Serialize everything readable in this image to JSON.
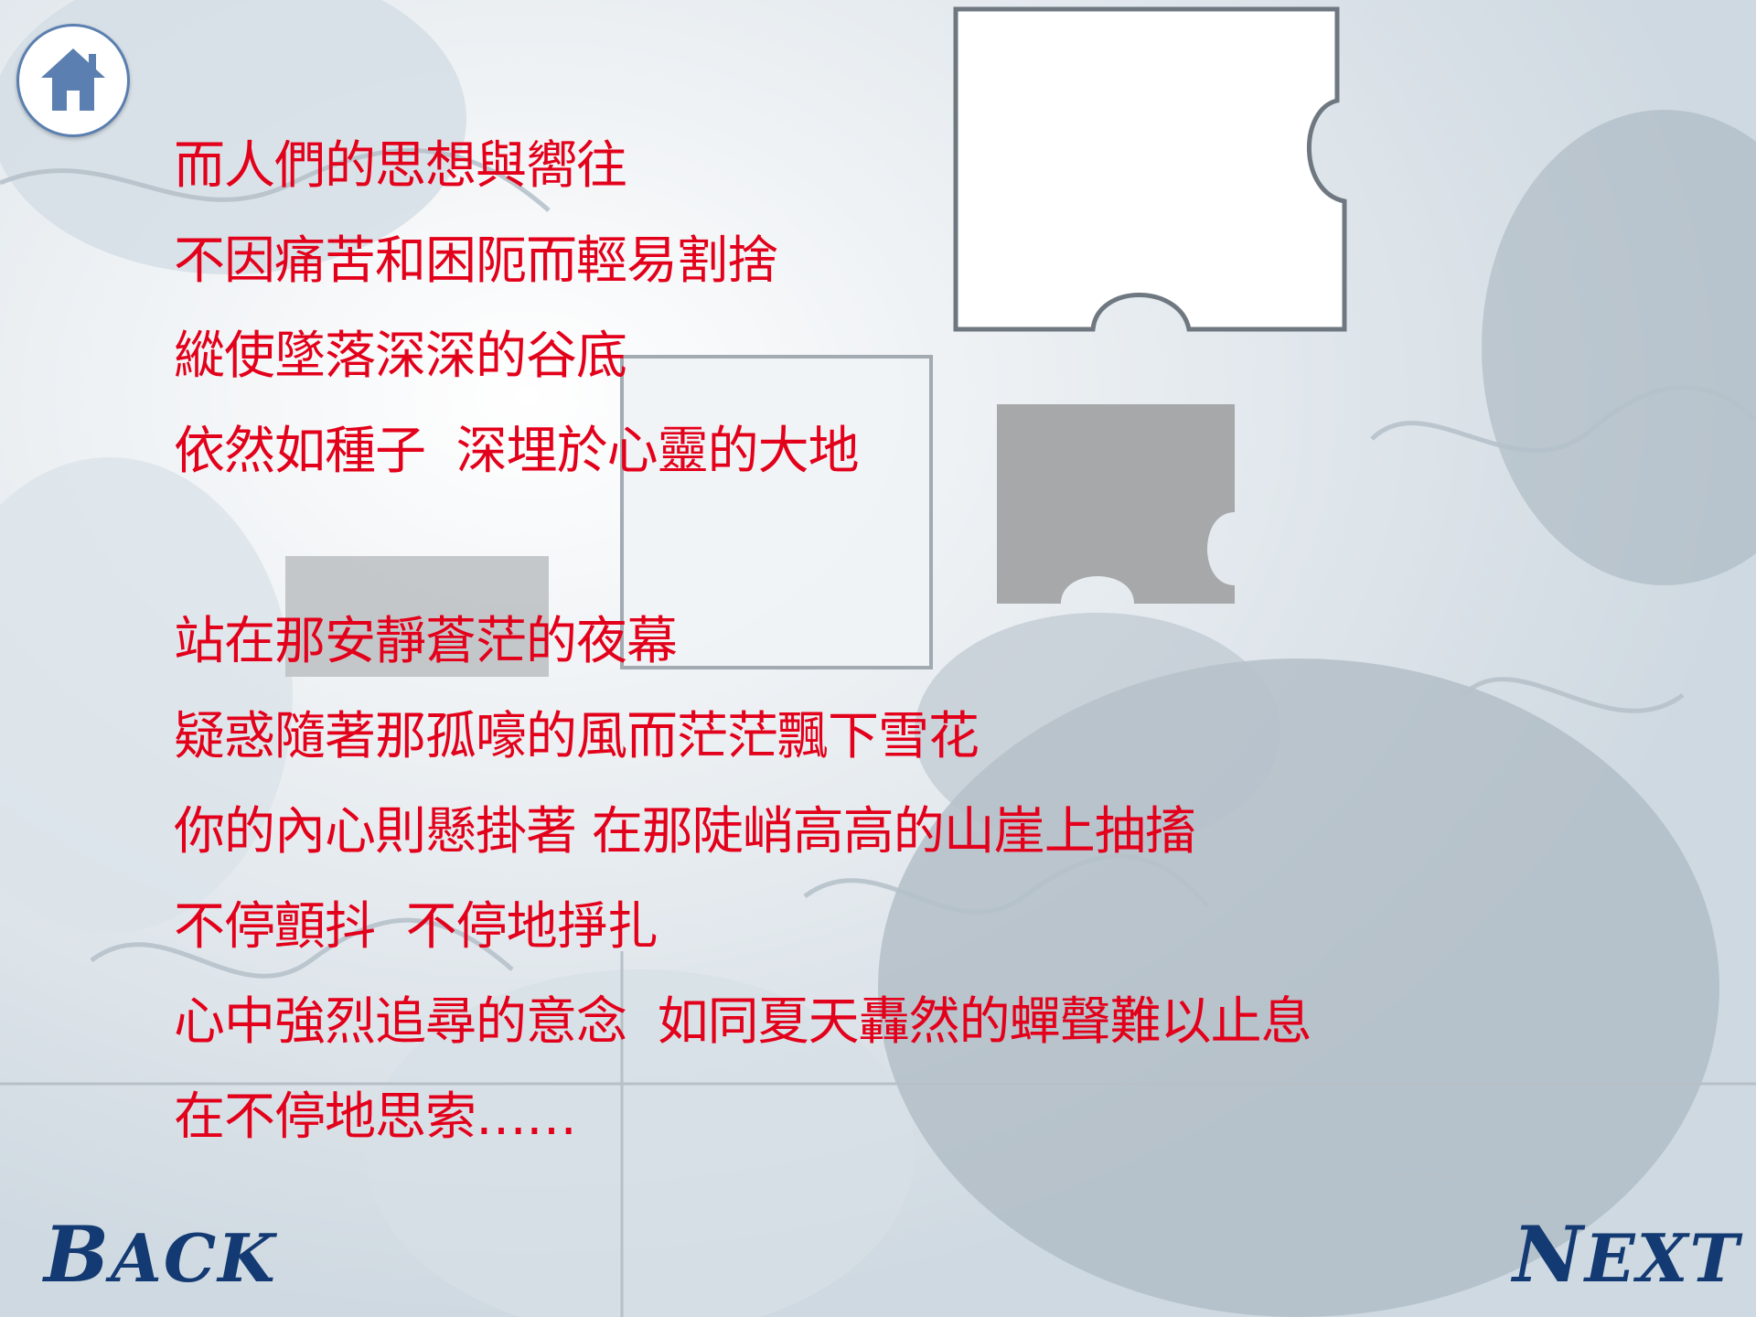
{
  "home": {
    "icon": "home-icon"
  },
  "poem": {
    "stanza1": [
      "而人們的思想與嚮往",
      "不因痛苦和困阨而輕易割捨",
      "縱使墜落深深的谷底",
      "依然如種子  深埋於心靈的大地"
    ],
    "stanza2": [
      "站在那安靜蒼茫的夜幕",
      "疑惑隨著那孤嚎的風而茫茫飄下雪花",
      "你的內心則懸掛著 在那陡峭高高的山崖上抽搐",
      "不停顫抖  不停地掙扎",
      "心中強烈追尋的意念  如同夏天轟然的蟬聲難以止息",
      "在不停地思索……"
    ]
  },
  "nav": {
    "back_first": "B",
    "back_rest": "ACK",
    "next_first": "N",
    "next_rest": "EXT"
  },
  "colors": {
    "poem_text": "#e3001b",
    "nav_text": "#133a72",
    "home_icon": "#5a7fb0"
  }
}
